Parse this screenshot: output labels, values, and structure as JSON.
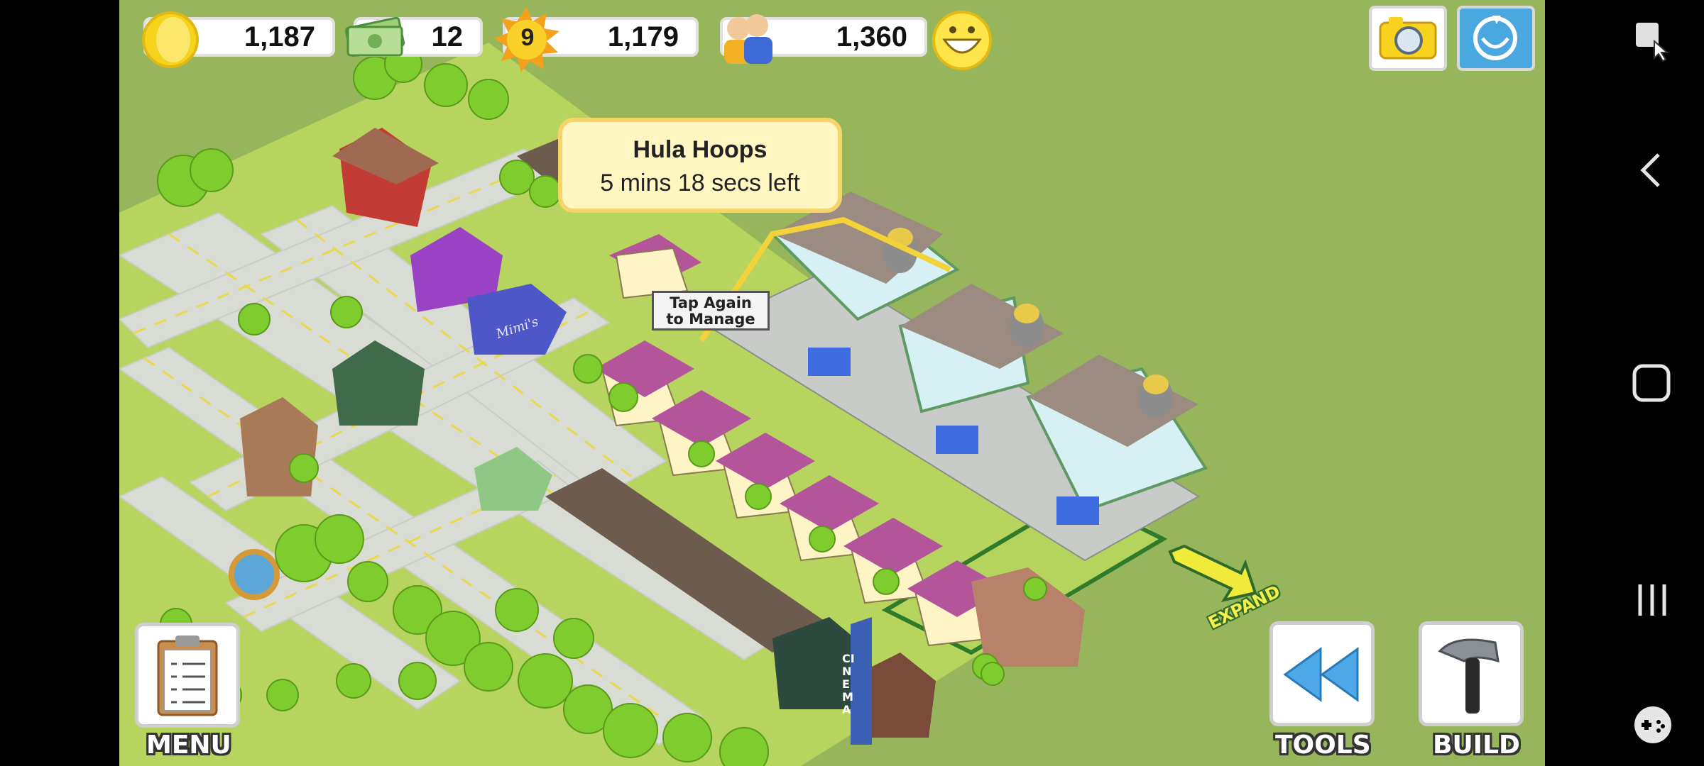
{
  "hud": {
    "coins": "1,187",
    "cash": "12",
    "level": "9",
    "xp": "1,179",
    "population": "1,360"
  },
  "tooltip": {
    "title": "Hula Hoops",
    "subtitle": "5 mins 18 secs left"
  },
  "building_sign": {
    "line1": "Tap Again",
    "line2": "to Manage"
  },
  "storefront_sign": "Mimi's",
  "cinema_sign": "CINEMA",
  "buttons": {
    "menu": "MENU",
    "tools": "TOOLS",
    "build": "BUILD",
    "expand": "EXPAND"
  },
  "icons": {
    "coins": "coin-icon",
    "cash": "cash-icon",
    "level": "sun-level-icon",
    "population": "population-icon",
    "happiness": "smiley-icon",
    "camera": "camera-icon",
    "social": "social-icon",
    "menu": "clipboard-icon",
    "tools": "rewind-icon",
    "build": "hammer-icon"
  },
  "colors": {
    "grass": "#97b55a",
    "tooltip_bg": "#fff6c2",
    "tooltip_border": "#f5d46a",
    "gold": "#f7d21e"
  }
}
